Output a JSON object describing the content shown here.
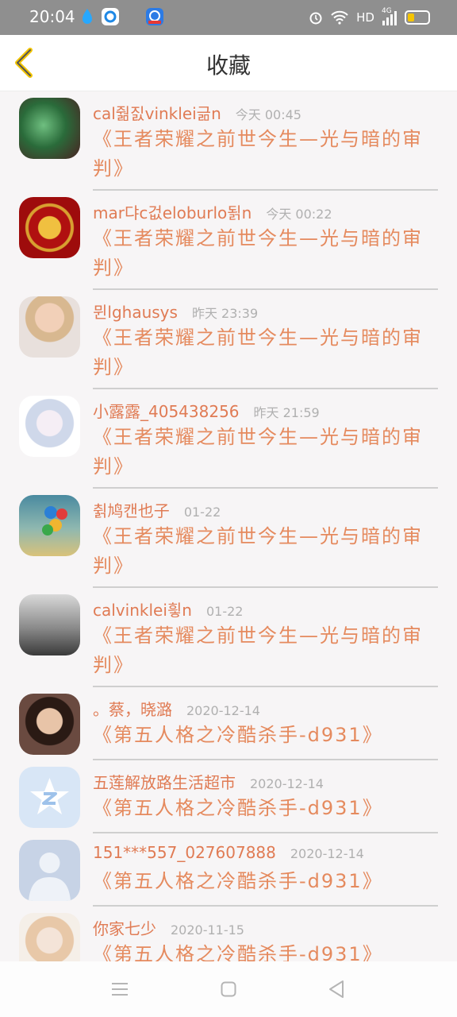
{
  "status_bar": {
    "time": "20:04",
    "network": "HD",
    "signal": "4G"
  },
  "header": {
    "title": "收藏"
  },
  "items": [
    {
      "name": "cal줢짌vinklei긂n",
      "time": "今天 00:45",
      "message": "《王者荣耀之前世今生—光与暗的审判》"
    },
    {
      "name": "mar댜c겂eloburlo됡n",
      "time": "今天 00:22",
      "message": "《王者荣耀之前世今生—光与暗的审判》"
    },
    {
      "name": "뮌lghausys",
      "time": "昨天 23:39",
      "message": "《王者荣耀之前世今生—光与暗的审判》"
    },
    {
      "name": "小露露_405438256",
      "time": "昨天 21:59",
      "message": "《王者荣耀之前世今生—光与暗的审判》"
    },
    {
      "name": "췱鸠캔也子",
      "time": "01-22",
      "message": "《王者荣耀之前世今生—光与暗的审判》"
    },
    {
      "name": "calvinklei힇n",
      "time": "01-22",
      "message": "《王者荣耀之前世今生—光与暗的审判》"
    },
    {
      "name": "。蔡，晓潞",
      "time": "2020-12-14",
      "message": "《第五人格之冷酷杀手-d931》"
    },
    {
      "name": "五莲解放路生活超市",
      "time": "2020-12-14",
      "message": "《第五人格之冷酷杀手-d931》"
    },
    {
      "name": "151***557_027607888",
      "time": "2020-12-14",
      "message": "《第五人格之冷酷杀手-d931》"
    },
    {
      "name": "你家七少",
      "time": "2020-11-15",
      "message": "《第五人格之冷酷杀手-d931》"
    }
  ]
}
